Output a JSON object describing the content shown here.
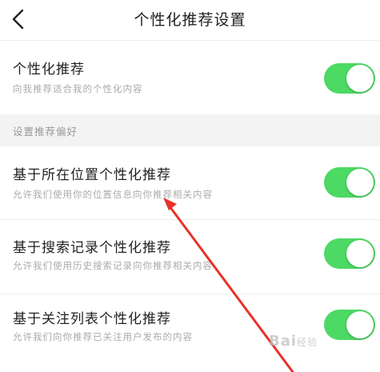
{
  "header": {
    "title": "个性化推荐设置",
    "back_icon": "chevron-left-icon"
  },
  "personalized": {
    "title": "个性化推荐",
    "subtitle": "向我推荐适合我的个性化内容",
    "enabled": true
  },
  "section": {
    "label": "设置推荐偏好"
  },
  "items": [
    {
      "title": "基于所在位置个性化推荐",
      "subtitle": "允许我们使用你的位置信息向你推荐相关内容",
      "enabled": true
    },
    {
      "title": "基于搜索记录个性化推荐",
      "subtitle": "允许我们使用历史搜索记录向你推荐相关内容",
      "enabled": true
    },
    {
      "title": "基于关注列表个性化推荐",
      "subtitle": "允许我们向你推荐已关注用户发布的内容",
      "enabled": true
    }
  ],
  "watermark": {
    "text": "Bai",
    "suffix": "经验"
  },
  "colors": {
    "toggle_on": "#4cd964",
    "annotation_arrow": "#e8312a",
    "section_bg": "#f3f3f3"
  }
}
